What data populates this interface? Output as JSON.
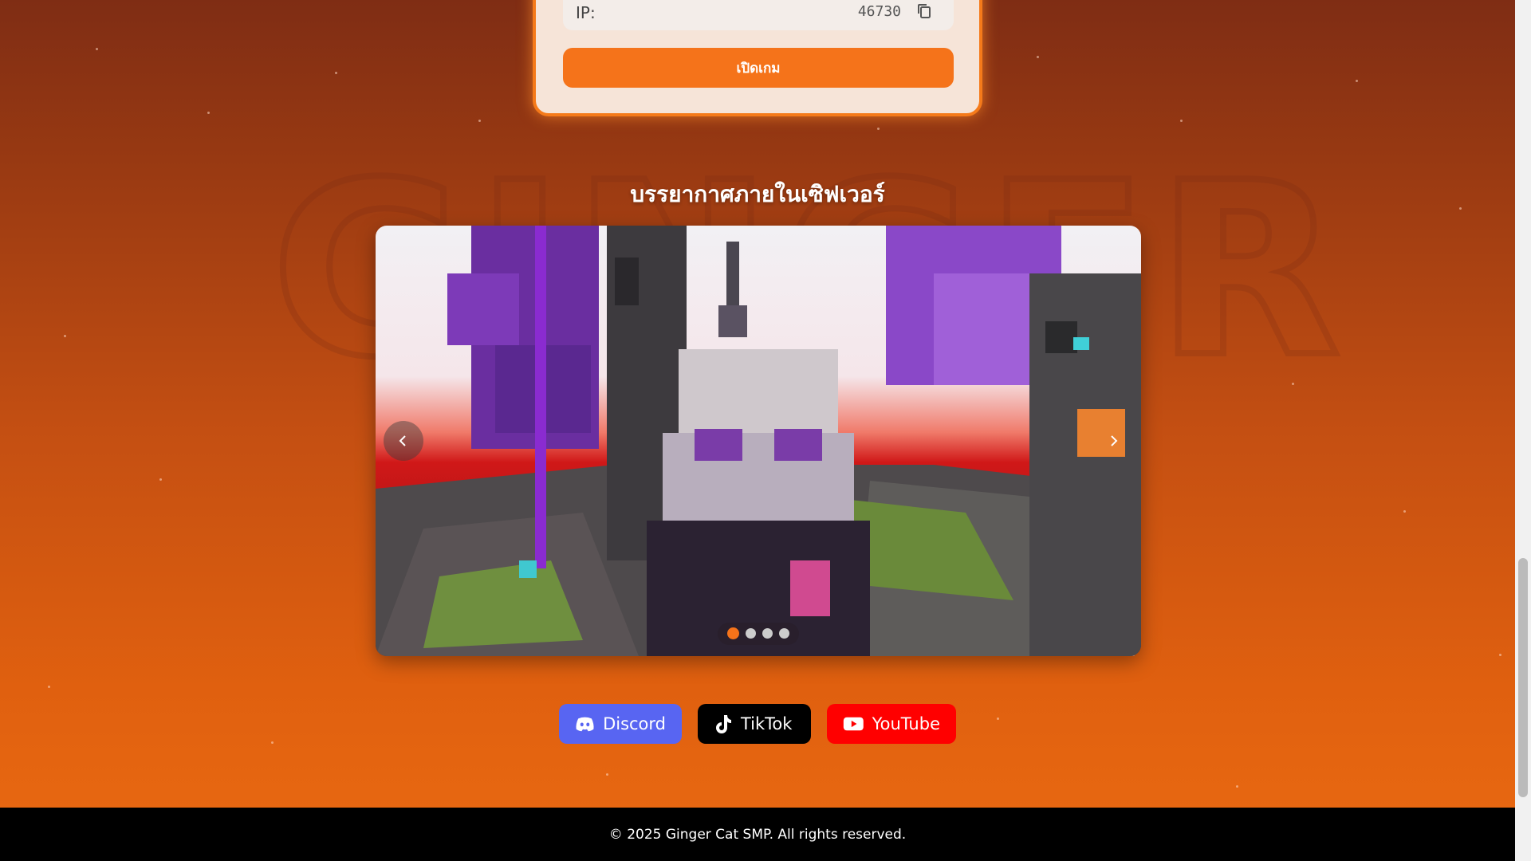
{
  "server_card": {
    "ip_label": "IP:",
    "ip_value": "46730",
    "play_label": "เปิดเกม"
  },
  "gallery": {
    "title": "บรรยากาศภายในเซิฟเวอร์",
    "slide_count": 4,
    "active_slide": 1
  },
  "socials": [
    {
      "label": "Discord",
      "icon": "discord-icon",
      "color": "#5865f2"
    },
    {
      "label": "TikTok",
      "icon": "tiktok-icon",
      "color": "#000000"
    },
    {
      "label": "YouTube",
      "icon": "youtube-icon",
      "color": "#ff0000"
    }
  ],
  "footer": {
    "text": "© 2025 Ginger Cat SMP. All rights reserved."
  },
  "colors": {
    "accent": "#f5731a",
    "card_border": "#f57a1a"
  }
}
